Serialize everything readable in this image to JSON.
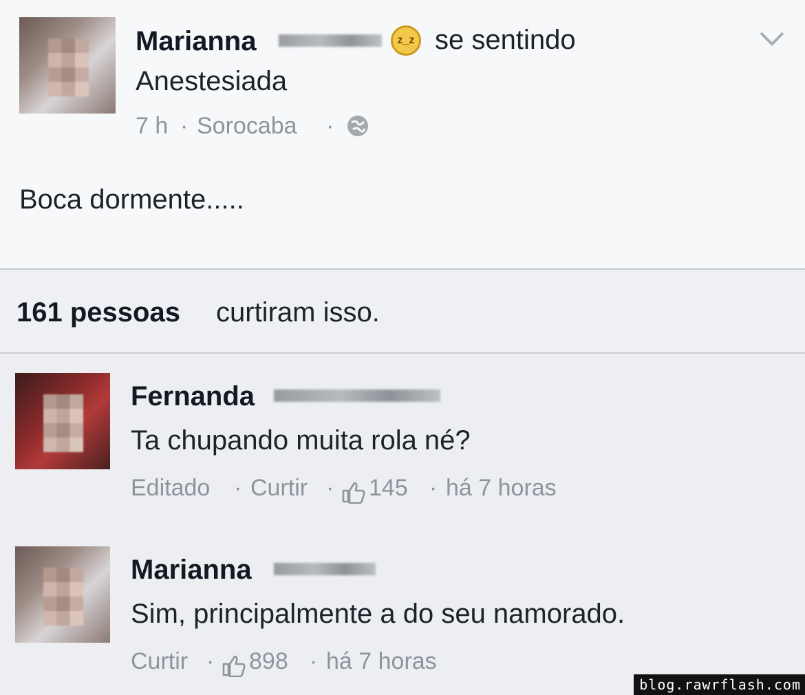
{
  "post": {
    "author": "Marianna",
    "feeling_prefix": "se sentindo",
    "feeling": "Anestesiada",
    "feeling_icon": "anesthetized-emoji-icon",
    "time": "7 h",
    "location": "Sorocaba",
    "privacy_icon": "globe-icon",
    "body": "Boca dormente....."
  },
  "likes": {
    "count_text": "161 pessoas",
    "suffix": "curtiram isso."
  },
  "comments": [
    {
      "author": "Fernanda",
      "text": "Ta chupando muita rola né?",
      "edited": "Editado",
      "like_action": "Curtir",
      "like_count": "145",
      "time": "há 7 horas"
    },
    {
      "author": "Marianna",
      "text": "Sim, principalmente a do seu namorado.",
      "like_action": "Curtir",
      "like_count": "898",
      "time": "há 7 horas"
    }
  ],
  "watermark": "blog.rawrflash.com",
  "colors": {
    "background": "#f6f7f9",
    "meta_text": "#8d949e",
    "primary_text": "#141823"
  }
}
